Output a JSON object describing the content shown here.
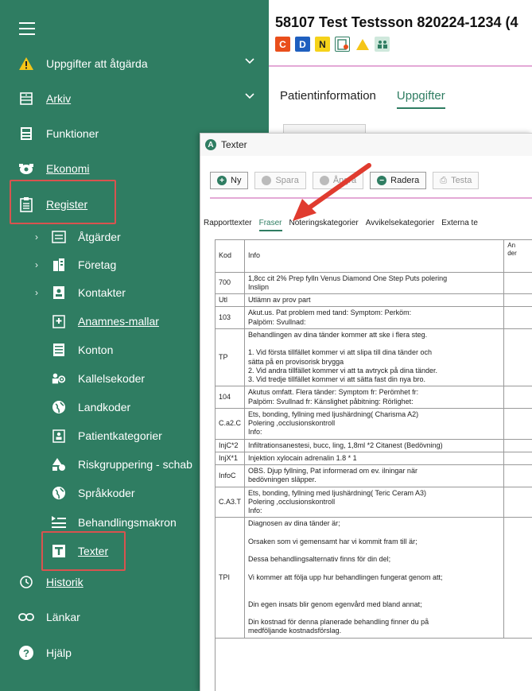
{
  "sidebar": {
    "items": [
      {
        "name": "uppgifter-att-atgarda",
        "label": "Uppgifter att åtgärda"
      },
      {
        "name": "arkiv",
        "label": "Arkiv"
      },
      {
        "name": "funktioner",
        "label": "Funktioner"
      },
      {
        "name": "ekonomi",
        "label": "Ekonomi"
      },
      {
        "name": "register",
        "label": "Register"
      }
    ],
    "register_items": [
      {
        "label": "Åtgärder"
      },
      {
        "label": "Företag"
      },
      {
        "label": "Kontakter"
      },
      {
        "label": "Anamnes-mallar"
      },
      {
        "label": "Konton"
      },
      {
        "label": "Kallelsekoder"
      },
      {
        "label": "Landkoder"
      },
      {
        "label": "Patientkategorier"
      },
      {
        "label": "Riskgruppering - schab"
      },
      {
        "label": "Språkkoder"
      },
      {
        "label": "Behandlingsmakron"
      },
      {
        "label": "Texter"
      }
    ],
    "bottom_items": [
      {
        "label": "Historik"
      },
      {
        "label": "Länkar"
      },
      {
        "label": "Hjälp"
      }
    ]
  },
  "header": {
    "patient": "58107 Test Testsson 820224-1234 (4",
    "badges": [
      "C",
      "D",
      "N"
    ],
    "tabs": [
      "Patientinformation",
      "Uppgifter"
    ]
  },
  "dialog": {
    "title": "Texter",
    "toolbar": {
      "ny": "Ny",
      "spara": "Spara",
      "angra": "Ångra",
      "radera": "Radera",
      "testa": "Testa"
    },
    "subtabs": [
      "Rapporttexter",
      "Fraser",
      "Noteringskategorier",
      "Avvikelsekategorier",
      "Externa te"
    ],
    "table": {
      "headers": {
        "kod": "Kod",
        "info": "Info",
        "extra": "An\nder"
      },
      "rows": [
        {
          "kod": "700",
          "info": "1,8cc cit 2% Prep fylln Venus Diamond One Step Puts polering\nInslipn"
        },
        {
          "kod": "Utl",
          "info": "Utlämn av prov part"
        },
        {
          "kod": "103",
          "info": "Akut.us. Pat problem med tand:   Symptom:   Perköm:\nPalpöm:   Svullnad:"
        },
        {
          "kod": "TP",
          "info": "Behandlingen  av dina tänder kommer att ske i flera steg.\n\n1. Vid första tillfället kommer vi att slipa till dina tänder och\nsätta på en      provisorisk brygga\n2. Vid andra tillfället kommer vi att ta avtryck på dina tänder.\n3. Vid tredje tillfället kommer vi att sätta fast din nya bro."
        },
        {
          "kod": "104",
          "info": "Akutus omfatt. Flera tänder:   Symptom fr:      Peröm­het fr:\nPalpöm:    Svullnad fr:    Känslighet påbitning:    Rörlighet:"
        },
        {
          "kod": "C.a2.C",
          "info": "Ets, bonding, fyllning med ljushärdning( Charisma A2)\nPolering ,occlusionskontroll\nInfo:"
        },
        {
          "kod": "InjC*2",
          "info": "Infiltrationsanestesi, bucc, ling, 1,8ml *2 Citanest (Bedövning)"
        },
        {
          "kod": "InjX*1",
          "info": "Injektion xylocain adrenalin 1.8 * 1"
        },
        {
          "kod": "InfoC",
          "info": "OBS. Djup fyllning, Pat informerad om ev. ilningar när\nbedövningen släpper."
        },
        {
          "kod": "C.A3.T",
          "info": "Ets, bonding, fyllning med ljushärdning( Teric Ceram A3)\nPolering ,occlusionskontroll\nInfo:"
        },
        {
          "kod": "TPI",
          "info": "Diagnosen av dina tänder är;\n\nOrsaken som vi gemensamt  har vi kommit fram till är;\n\nDessa behandlingsalternativ finns för din del;\n\nVi kommer att följa upp hur behandlingen fungerat genom att;\n\n\nDin egen insats blir genom egenvård med bland annat;\n\nDin kostnad för denna planerade behandling finner du på\nmedföljande kostnadsförslag."
        }
      ]
    }
  },
  "colors": {
    "sidebar": "#2f7d62",
    "accent": "#2f7d62",
    "highlight": "#d9534f",
    "pink": "#e4a9d6"
  }
}
